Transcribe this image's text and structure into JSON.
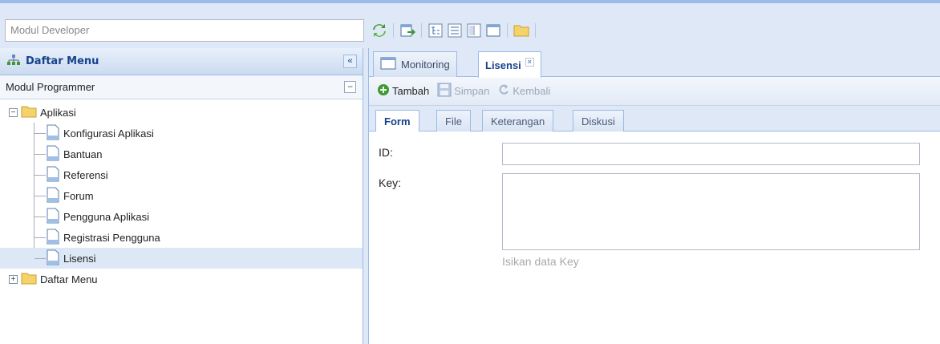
{
  "module_input": {
    "value": "Modul Developer"
  },
  "toolbar": {
    "icons": [
      "refresh-icon",
      "export-icon",
      "tree-icon",
      "list-icon",
      "columns-icon",
      "window-icon",
      "folder-icon"
    ]
  },
  "left_panel": {
    "title": "Daftar Menu",
    "collapse_label": "«",
    "section_label": "Modul Programmer",
    "tree": {
      "root": {
        "label": "Aplikasi",
        "toggle": "−",
        "children": [
          "Konfigurasi Aplikasi",
          "Bantuan",
          "Referensi",
          "Forum",
          "Pengguna Aplikasi",
          "Registrasi Pengguna",
          "Lisensi"
        ]
      },
      "second_root": {
        "label": "Daftar Menu",
        "toggle": "+"
      }
    }
  },
  "tabs": [
    {
      "label": "Monitoring"
    },
    {
      "label": "Lisensi",
      "close": "×"
    }
  ],
  "actions": {
    "add": "Tambah",
    "save": "Simpan",
    "back": "Kembali"
  },
  "subtabs": [
    "Form",
    "File",
    "Keterangan",
    "Diskusi"
  ],
  "form": {
    "id_label": "ID:",
    "id_value": "",
    "key_label": "Key:",
    "key_value": "",
    "key_hint": "Isikan data Key"
  },
  "colors": {
    "panel_border": "#99bbe8",
    "header_bg": "#dfe8f6",
    "title": "#15428b",
    "selected_row": "#dde8f7"
  }
}
